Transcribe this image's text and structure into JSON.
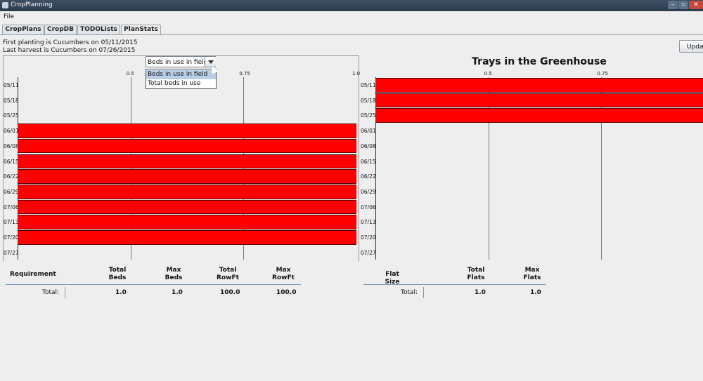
{
  "window": {
    "title": "CropPlanning"
  },
  "menu": {
    "file": "File"
  },
  "tabs": [
    {
      "label": "CropPlans"
    },
    {
      "label": "CropDB"
    },
    {
      "label": "TODOLists"
    },
    {
      "label": "PlanStats"
    }
  ],
  "info": {
    "first_planting": "First planting is Cucumbers on 05/11/2015",
    "last_harvest": "Last harvest is Cucumbers on 07/26/2015"
  },
  "update_button": "Upda",
  "beds_chart": {
    "combo_selected": "Beds in use in field",
    "combo_options": [
      "Beds in use in field",
      "Total beds in use"
    ],
    "x_ticks": [
      "0.5",
      "0.75",
      "1.0"
    ],
    "rows": [
      {
        "label": "05/11",
        "value": 0
      },
      {
        "label": "05/18",
        "value": 0
      },
      {
        "label": "05/25",
        "value": 0
      },
      {
        "label": "06/01",
        "value": 1.0
      },
      {
        "label": "06/08",
        "value": 1.0
      },
      {
        "label": "06/15",
        "value": 1.0
      },
      {
        "label": "06/22",
        "value": 1.0
      },
      {
        "label": "06/29",
        "value": 1.0
      },
      {
        "label": "07/06",
        "value": 1.0
      },
      {
        "label": "07/13",
        "value": 1.0
      },
      {
        "label": "07/20",
        "value": 1.0
      },
      {
        "label": "07/27",
        "value": 0
      }
    ]
  },
  "trays_chart": {
    "title": "Trays in the Greenhouse",
    "x_ticks": [
      "0.5",
      "0.75"
    ],
    "rows": [
      {
        "label": "05/11",
        "value": 1.0
      },
      {
        "label": "05/18",
        "value": 1.0
      },
      {
        "label": "05/25",
        "value": 1.0
      },
      {
        "label": "06/01",
        "value": 0
      },
      {
        "label": "06/08",
        "value": 0
      },
      {
        "label": "06/15",
        "value": 0
      },
      {
        "label": "06/22",
        "value": 0
      },
      {
        "label": "06/29",
        "value": 0
      },
      {
        "label": "07/06",
        "value": 0
      },
      {
        "label": "07/13",
        "value": 0
      },
      {
        "label": "07/20",
        "value": 0
      },
      {
        "label": "07/27",
        "value": 0
      }
    ]
  },
  "beds_table": {
    "headers": [
      "Requirement",
      "Total\nBeds",
      "Max\nBeds",
      "Total\nRowFt",
      "Max\nRowFt"
    ],
    "total_label": "Total:",
    "values": [
      "1.0",
      "1.0",
      "100.0",
      "100.0"
    ]
  },
  "flats_table": {
    "headers": [
      "Flat Size",
      "Total\nFlats",
      "Max\nFlats"
    ],
    "total_label": "Total:",
    "values": [
      "1.0",
      "1.0"
    ]
  },
  "colors": {
    "bar": "#ff0000",
    "titlebar": "#2c3a4c"
  }
}
